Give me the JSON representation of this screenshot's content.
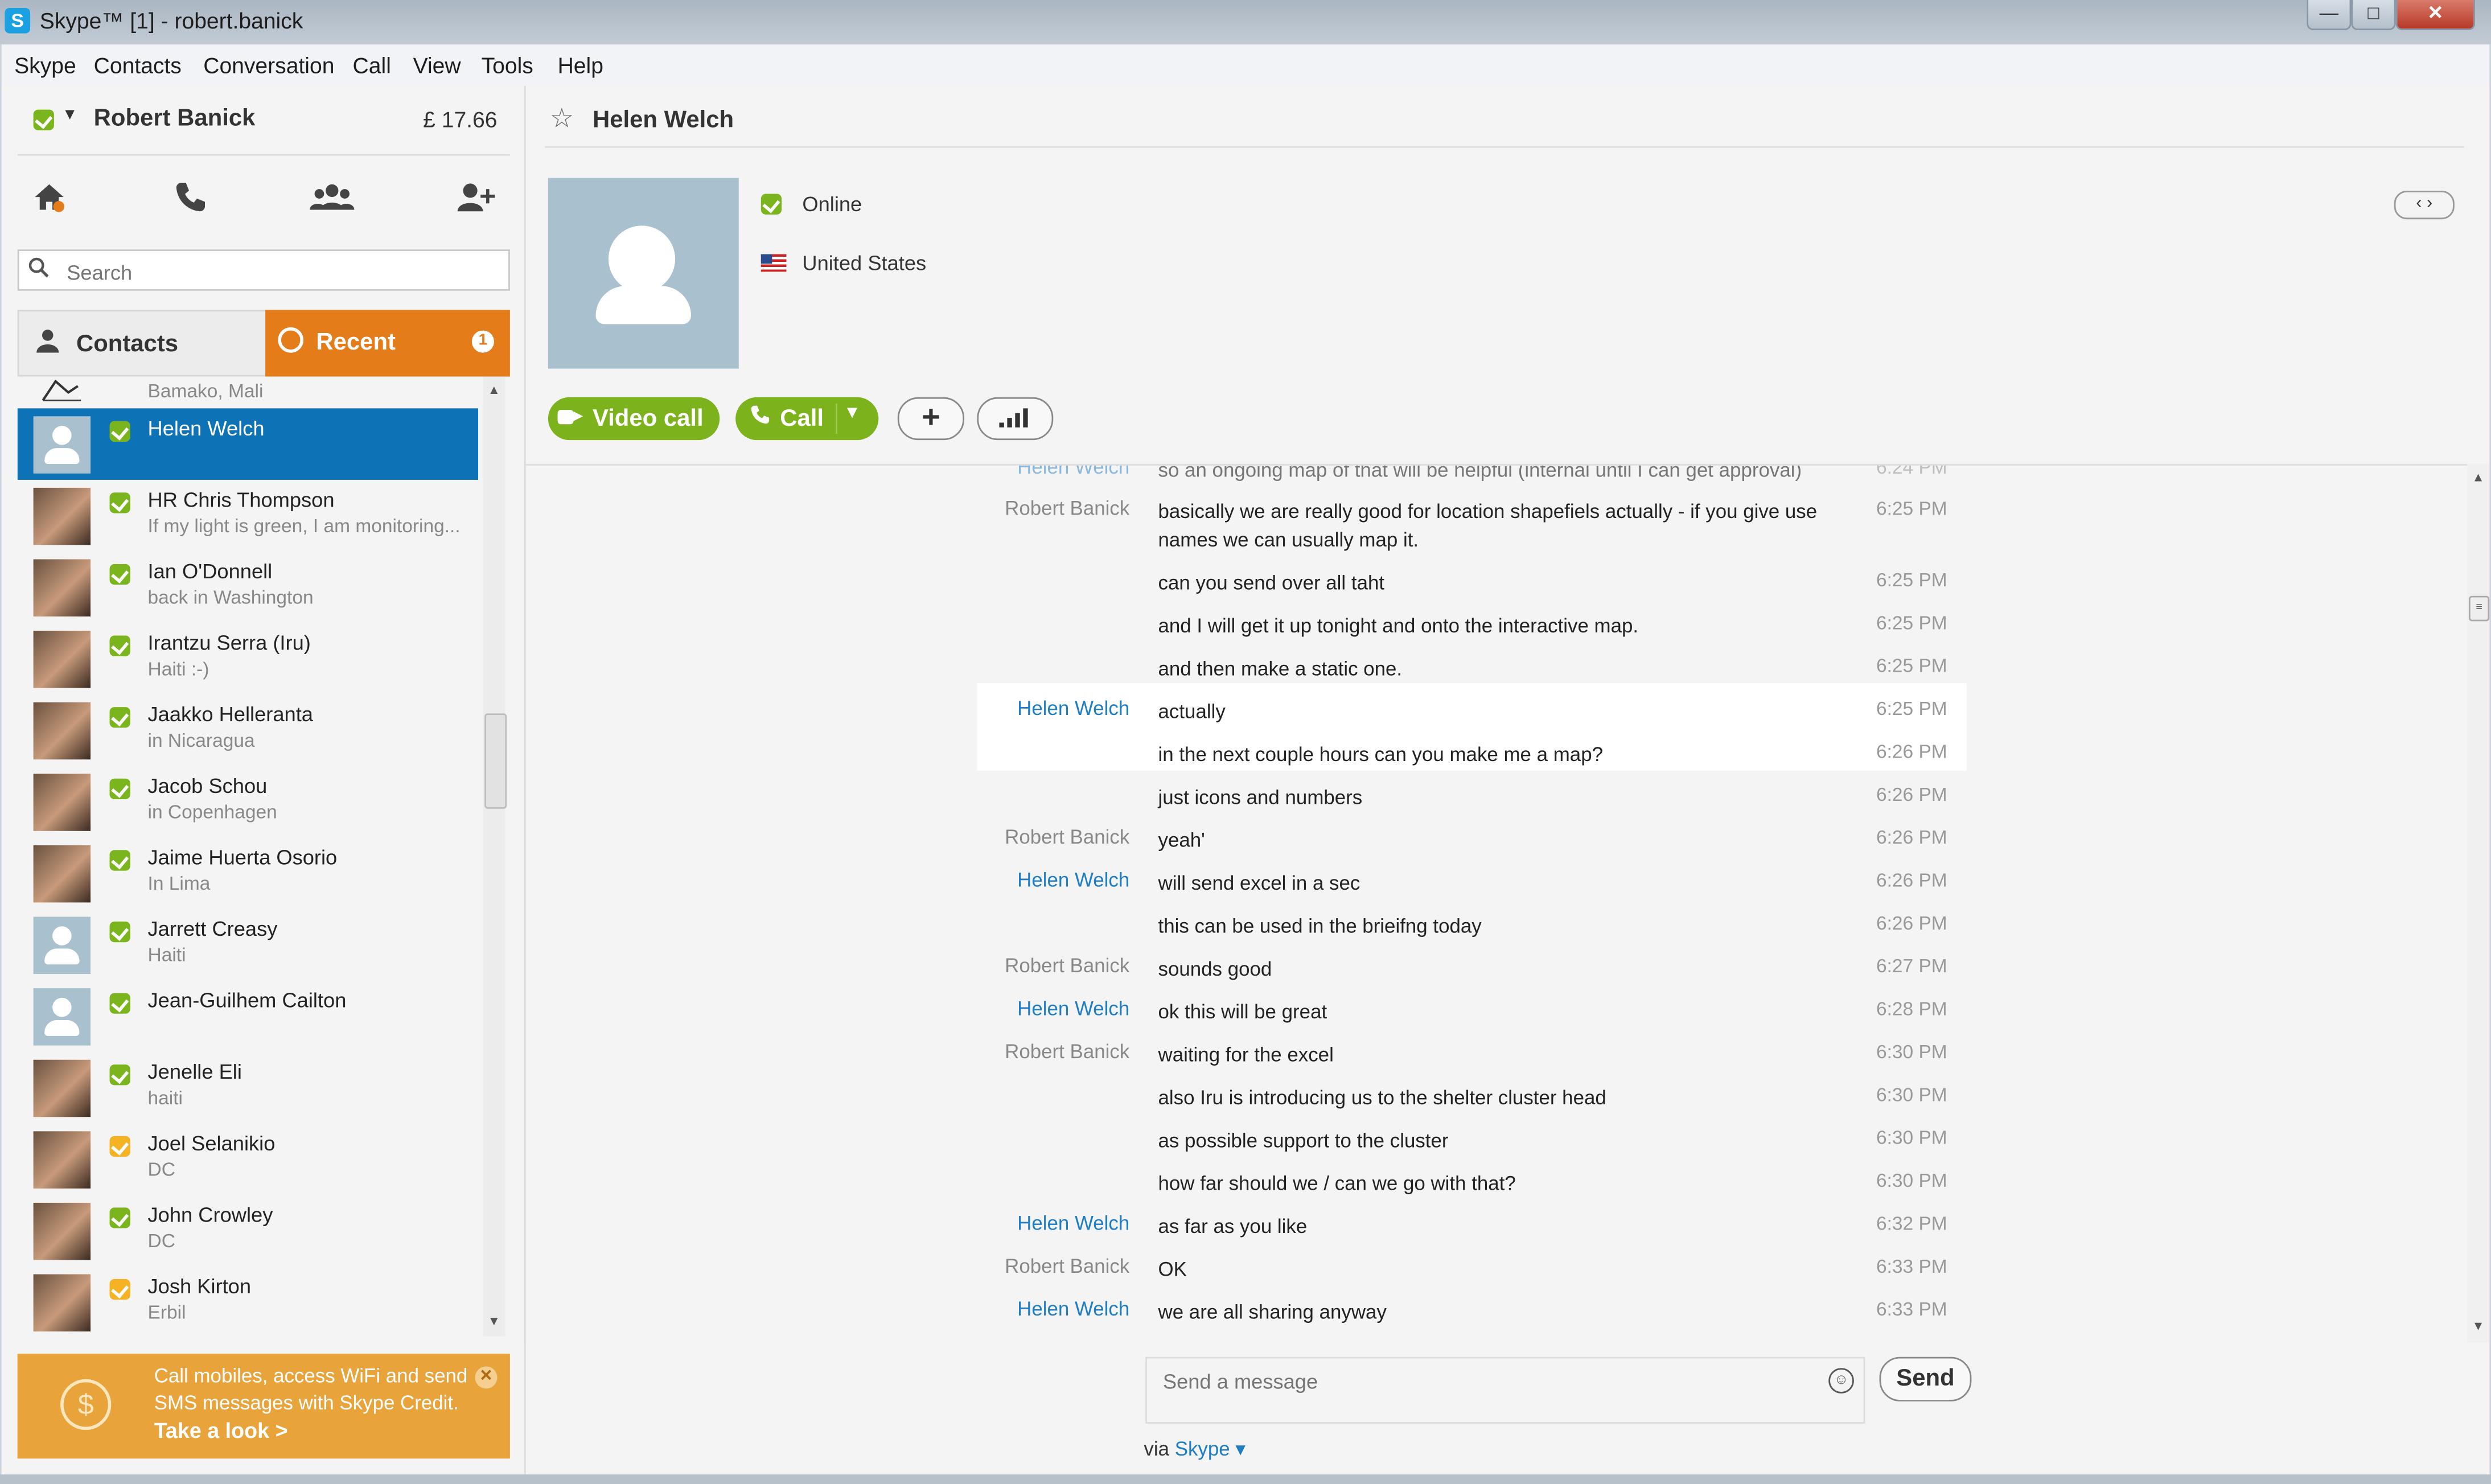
{
  "window": {
    "title": "Skype™ [1] - robert.banick",
    "app_icon": "S",
    "controls": {
      "minimize": "—",
      "maximize": "□",
      "close": "✕"
    }
  },
  "menu": [
    "Skype",
    "Contacts",
    "Conversation",
    "Call",
    "View",
    "Tools",
    "Help"
  ],
  "me": {
    "name": "Robert Banick",
    "credit": "£ 17.66",
    "status": "online"
  },
  "nav_icons": [
    "home-icon",
    "phone-icon",
    "group-icon",
    "add-contact-icon"
  ],
  "search": {
    "placeholder": "Search",
    "value": ""
  },
  "tabs": {
    "contacts": "Contacts",
    "recent": "Recent",
    "recent_badge": "1"
  },
  "contacts_partial": {
    "mood": "Bamako, Mali"
  },
  "contacts": [
    {
      "name": "Helen Welch",
      "mood": "",
      "status": "online",
      "avatar": "default",
      "selected": true
    },
    {
      "name": "HR Chris Thompson",
      "mood": "If my light is green, I am monitoring...",
      "status": "online",
      "avatar": "photo"
    },
    {
      "name": "Ian O'Donnell",
      "mood": "back in Washington",
      "status": "online",
      "avatar": "photo"
    },
    {
      "name": "Irantzu Serra (Iru)",
      "mood": "Haiti :-)",
      "status": "online",
      "avatar": "photo"
    },
    {
      "name": "Jaakko Helleranta",
      "mood": "in Nicaragua",
      "status": "online",
      "avatar": "photo"
    },
    {
      "name": "Jacob Schou",
      "mood": "in Copenhagen",
      "status": "online",
      "avatar": "photo"
    },
    {
      "name": "Jaime  Huerta Osorio",
      "mood": "In Lima",
      "status": "online",
      "avatar": "photo"
    },
    {
      "name": "Jarrett Creasy",
      "mood": "Haiti",
      "status": "online",
      "avatar": "default"
    },
    {
      "name": "Jean-Guilhem Cailton",
      "mood": "",
      "status": "online",
      "avatar": "default"
    },
    {
      "name": "Jenelle Eli",
      "mood": "haiti",
      "status": "online",
      "avatar": "photo"
    },
    {
      "name": "Joel Selanikio",
      "mood": "DC",
      "status": "away",
      "avatar": "photo"
    },
    {
      "name": "John Crowley",
      "mood": "DC",
      "status": "online",
      "avatar": "photo"
    },
    {
      "name": "Josh Kirton",
      "mood": "Erbil",
      "status": "away",
      "avatar": "photo"
    }
  ],
  "promo": {
    "text": "Call mobiles, access WiFi and send SMS messages with Skype Credit.",
    "link": "Take a look >",
    "coin": "$"
  },
  "profile": {
    "name": "Helen Welch",
    "status": "Online",
    "country": "United States",
    "nav_arrows": "‹ ›"
  },
  "actions": {
    "video_call": "Video call",
    "call": "Call",
    "add": "+"
  },
  "messages": [
    {
      "sender": "Robert Banick",
      "text": "basically we are really good for location shapefiels actually - if you give use names we can usually map it.",
      "time": "6:25 PM"
    },
    {
      "sender": "",
      "text": "can you send over all taht",
      "time": "6:25 PM"
    },
    {
      "sender": "",
      "text": "and I will get it up tonight and onto the interactive map.",
      "time": "6:25 PM"
    },
    {
      "sender": "",
      "text": "and then make a static one.",
      "time": "6:25 PM"
    },
    {
      "sender": "Helen Welch",
      "text": "actually",
      "time": "6:25 PM"
    },
    {
      "sender": "",
      "text": "in the next couple hours can you make me a map?",
      "time": "6:26 PM"
    },
    {
      "sender": "",
      "text": "just icons and numbers",
      "time": "6:26 PM"
    },
    {
      "sender": "Robert Banick",
      "text": "yeah'",
      "time": "6:26 PM"
    },
    {
      "sender": "Helen Welch",
      "text": "will send excel in a sec",
      "time": "6:26 PM"
    },
    {
      "sender": "",
      "text": "this can be used in the brieifng today",
      "time": "6:26 PM"
    },
    {
      "sender": "Robert Banick",
      "text": "sounds good",
      "time": "6:27 PM"
    },
    {
      "sender": "Helen Welch",
      "text": "ok this will be great",
      "time": "6:28 PM"
    },
    {
      "sender": "Robert Banick",
      "text": "waiting for the excel",
      "time": "6:30 PM"
    },
    {
      "sender": "",
      "text": "also Iru is introducing us to the shelter cluster head",
      "time": "6:30 PM"
    },
    {
      "sender": "",
      "text": "as possible support to the cluster",
      "time": "6:30 PM"
    },
    {
      "sender": "",
      "text": "how far should we / can we go with that?",
      "time": "6:30 PM"
    },
    {
      "sender": "Helen Welch",
      "text": "as far as you like",
      "time": "6:32 PM"
    },
    {
      "sender": "Robert Banick",
      "text": "OK",
      "time": "6:33 PM"
    },
    {
      "sender": "Helen Welch",
      "text": "we are all sharing anyway",
      "time": "6:33 PM"
    }
  ],
  "composer": {
    "placeholder": "Send a message",
    "send": "Send",
    "via_prefix": "via",
    "via_link": "Skype ▾"
  },
  "colors": {
    "online": "#7bb51d",
    "away": "#f5b324",
    "selected": "#0d73b6",
    "recent_tab": "#e57c1a",
    "promo": "#e8a33a",
    "link": "#1e7dc3"
  }
}
